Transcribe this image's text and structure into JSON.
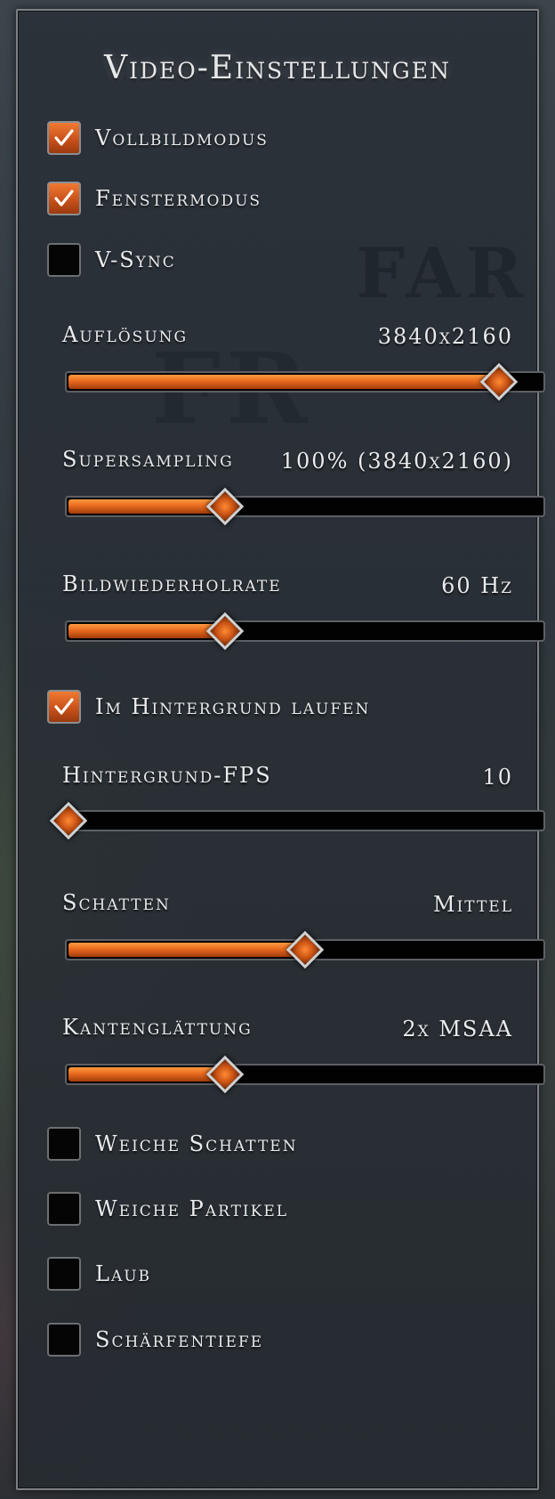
{
  "title": "Video-Einstellungen",
  "watermark": {
    "line1": "FAR",
    "line2": "FR"
  },
  "checkboxes_top": [
    {
      "label": "Vollbildmodus",
      "checked": true
    },
    {
      "label": "Fenstermodus",
      "checked": true
    },
    {
      "label": "V-Sync",
      "checked": false
    }
  ],
  "sliders": [
    {
      "label": "Auflösung",
      "value": "3840x2160",
      "fraction": 0.91
    },
    {
      "label": "Supersampling",
      "value": "100% (3840x2160)",
      "fraction": 0.33
    },
    {
      "label": "Bildwiederholrate",
      "value": "60 Hz",
      "fraction": 0.33
    }
  ],
  "background_checkbox": {
    "label": "Im Hintergrund laufen",
    "checked": true
  },
  "sliders_2": [
    {
      "label": "Hintergrund-FPS",
      "value": "10",
      "fraction": 0.0
    },
    {
      "label": "Schatten",
      "value": "Mittel",
      "fraction": 0.5
    },
    {
      "label": "Kantenglättung",
      "value": "2x MSAA",
      "fraction": 0.33
    }
  ],
  "checkboxes_bottom": [
    {
      "label": "Weiche Schatten",
      "checked": false
    },
    {
      "label": "Weiche Partikel",
      "checked": false
    },
    {
      "label": "Laub",
      "checked": false
    },
    {
      "label": "Schärfentiefe",
      "checked": false
    }
  ],
  "colors": {
    "accent": "#e86a1e",
    "panel": "#2a3038",
    "text": "#e9ebed"
  },
  "icons": {
    "check": "checkmark-icon",
    "knob": "diamond-slider-handle"
  }
}
